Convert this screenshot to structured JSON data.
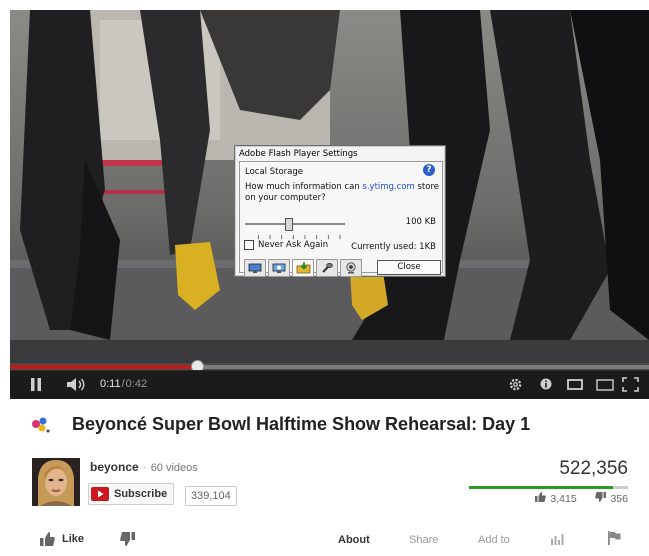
{
  "video": {
    "current_time": "0:11",
    "duration": "0:42",
    "progress_fraction": 0.29,
    "time_separator": "/"
  },
  "flash_dialog": {
    "window_title": "Adobe Flash Player Settings",
    "heading": "Local Storage",
    "question_prefix": "How much information can ",
    "question_host": "s.ytimg.com",
    "question_suffix": " store on your computer?",
    "storage_limit": "100 KB",
    "never_ask_label": "Never Ask Again",
    "currently_used": "Currently used: 1KB",
    "close_label": "Close",
    "help_glyph": "?"
  },
  "video_title": "Beyoncé Super Bowl Halftime Show Rehearsal: Day 1",
  "channel": {
    "name": "beyonce",
    "video_count": "60 videos",
    "subscribe_label": "Subscribe",
    "subscriber_count": "339,104"
  },
  "stats": {
    "views": "522,356",
    "likes": "3,415",
    "dislikes": "356",
    "like_fraction": 0.906
  },
  "actions": {
    "like": "Like",
    "about": "About",
    "share": "Share",
    "add_to": "Add to"
  },
  "colors": {
    "progress_played": "#c31b16",
    "like_bar": "#2a9b1e",
    "subscribe_red": "#cc181e",
    "flash_link": "#1a4fd6"
  },
  "icons": [
    "pause-icon",
    "volume-icon",
    "settings-gear-icon",
    "annotations-icon",
    "small-player-icon",
    "large-player-icon",
    "fullscreen-icon",
    "music-note-badge-icon",
    "youtube-logo-icon",
    "thumbs-up-icon",
    "thumbs-down-icon",
    "stats-icon",
    "flag-icon",
    "help-icon"
  ]
}
